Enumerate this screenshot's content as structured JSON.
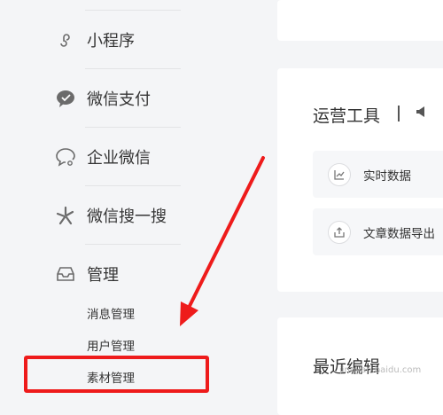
{
  "sidebar": {
    "items": [
      {
        "label": "小程序",
        "icon": "mini-program-icon"
      },
      {
        "label": "微信支付",
        "icon": "wechat-pay-icon"
      },
      {
        "label": "企业微信",
        "icon": "wecom-icon"
      },
      {
        "label": "微信搜一搜",
        "icon": "wechat-search-icon"
      },
      {
        "label": "管理",
        "icon": "inbox-icon"
      }
    ],
    "management_subitems": [
      "消息管理",
      "用户管理",
      "素材管理"
    ]
  },
  "operation_tools": {
    "title": "运营工具",
    "items": [
      {
        "label": "实时数据",
        "icon": "chart-icon"
      },
      {
        "label": "文章数据导出",
        "icon": "export-icon"
      }
    ]
  },
  "recent_edits": {
    "title": "最近编辑"
  },
  "watermark": "jingyan.baidu.com",
  "colors": {
    "annotation_red": "#ee1b1b",
    "card_bg": "#ffffff",
    "page_bg": "#f4f5f7"
  }
}
